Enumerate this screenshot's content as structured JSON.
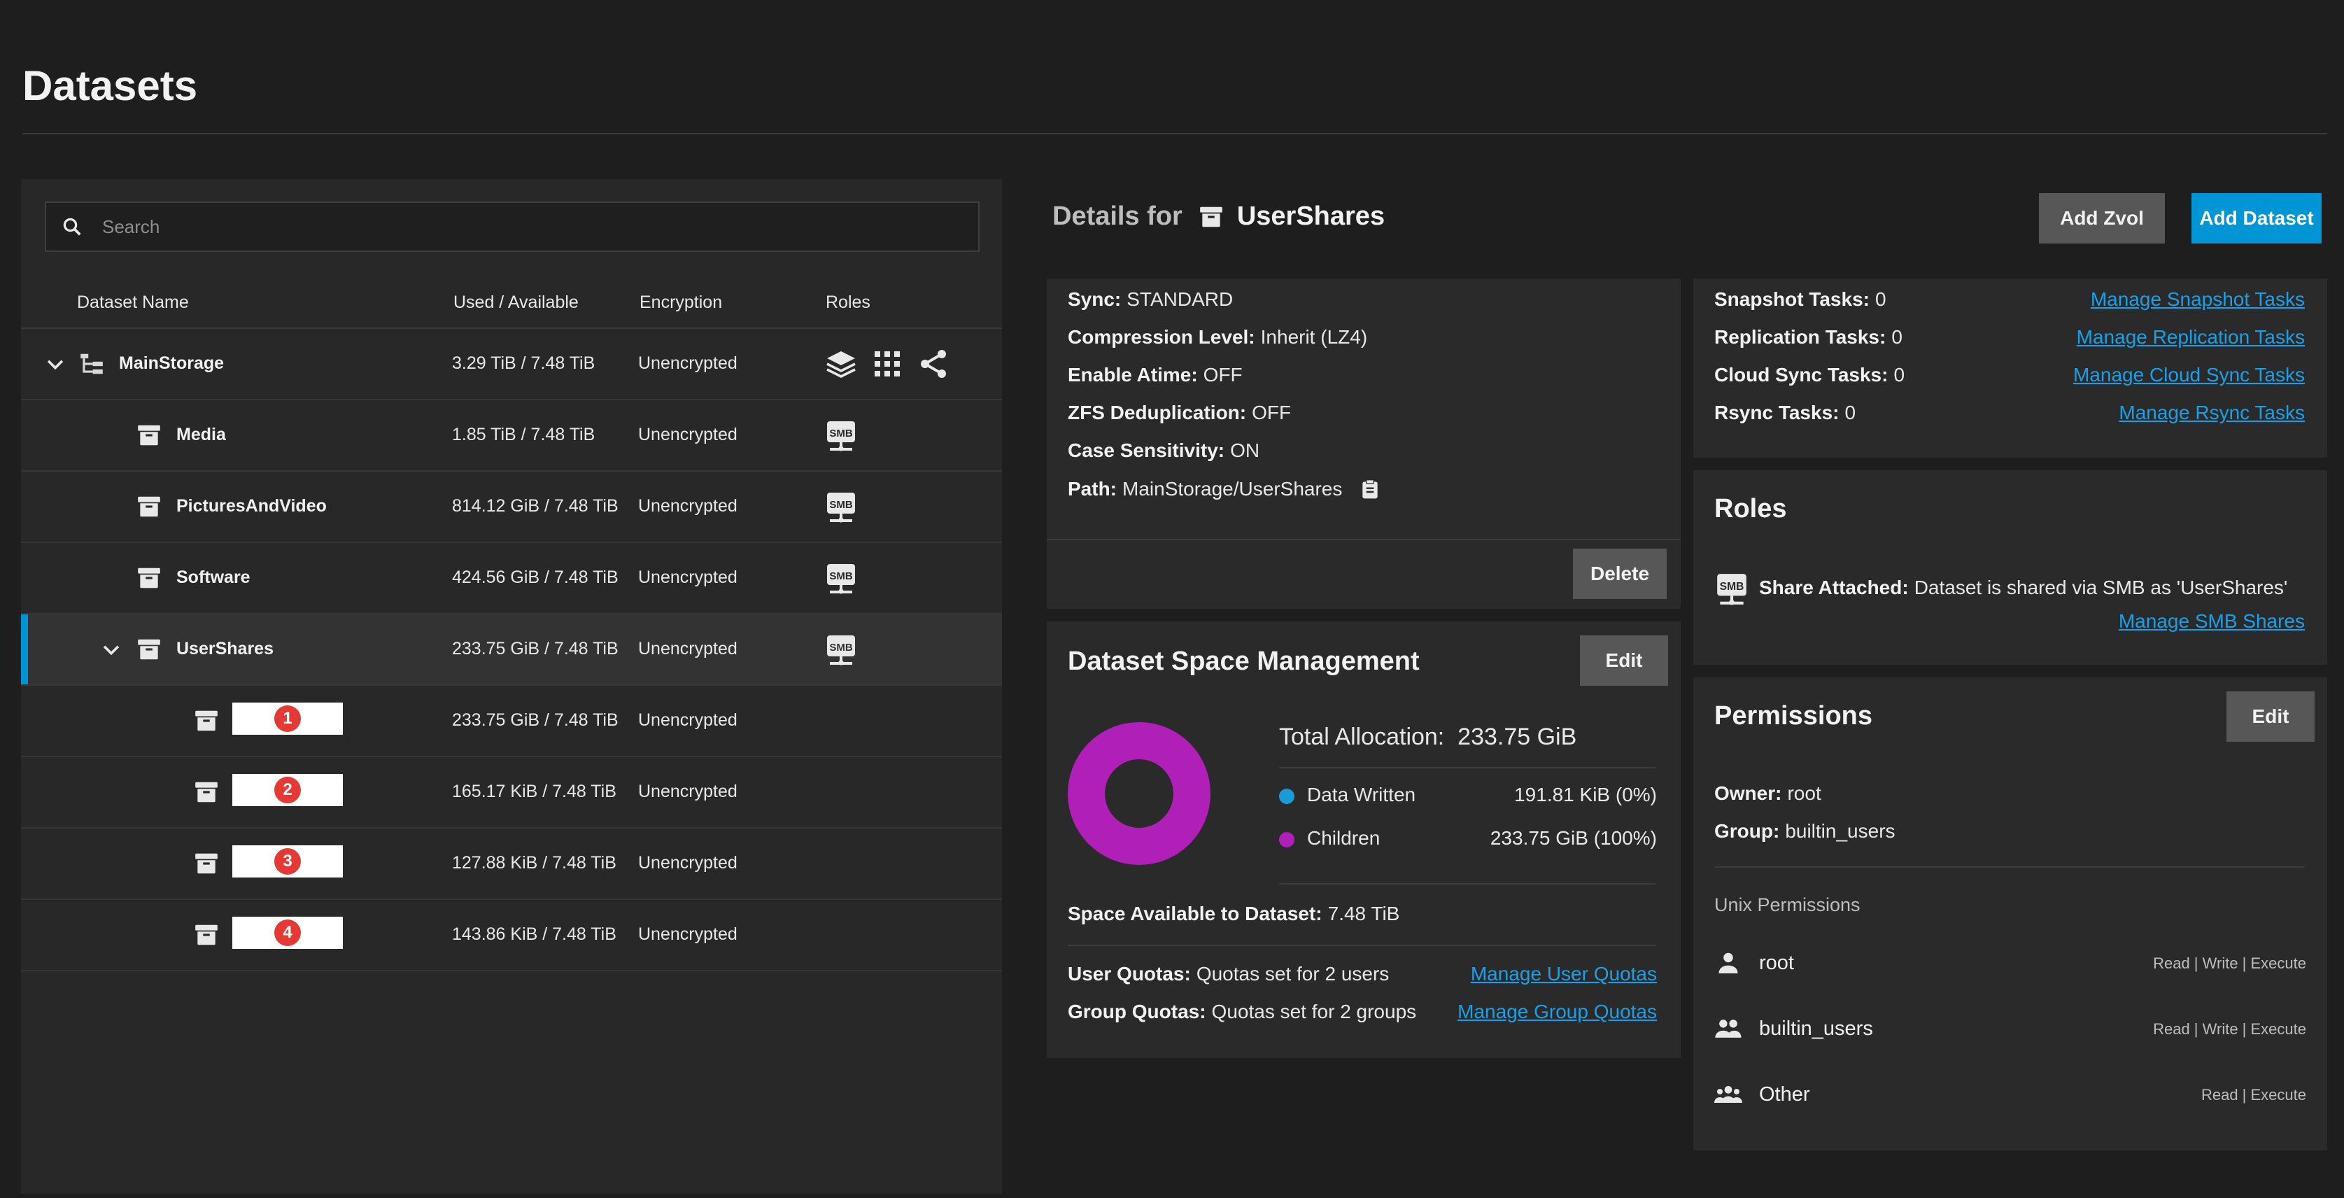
{
  "page": {
    "title": "Datasets"
  },
  "search": {
    "placeholder": "Search"
  },
  "tree": {
    "columns": {
      "name": "Dataset Name",
      "used": "Used / Available",
      "encryption": "Encryption",
      "roles": "Roles"
    },
    "rows": [
      {
        "name": "MainStorage",
        "used": "3.29 TiB / 7.48 TiB",
        "encryption": "Unencrypted",
        "roles": [
          "storage-stack-icon",
          "apps-grid-icon",
          "share-icon"
        ]
      },
      {
        "name": "Media",
        "used": "1.85 TiB / 7.48 TiB",
        "encryption": "Unencrypted",
        "roles": [
          "smb-share-icon"
        ]
      },
      {
        "name": "PicturesAndVideo",
        "used": "814.12 GiB / 7.48 TiB",
        "encryption": "Unencrypted",
        "roles": [
          "smb-share-icon"
        ]
      },
      {
        "name": "Software",
        "used": "424.56 GiB / 7.48 TiB",
        "encryption": "Unencrypted",
        "roles": [
          "smb-share-icon"
        ]
      },
      {
        "name": "UserShares",
        "used": "233.75 GiB / 7.48 TiB",
        "encryption": "Unencrypted",
        "roles": [
          "smb-share-icon"
        ]
      },
      {
        "badge": "1",
        "used": "233.75 GiB / 7.48 TiB",
        "encryption": "Unencrypted"
      },
      {
        "badge": "2",
        "used": "165.17 KiB / 7.48 TiB",
        "encryption": "Unencrypted"
      },
      {
        "badge": "3",
        "used": "127.88 KiB / 7.48 TiB",
        "encryption": "Unencrypted"
      },
      {
        "badge": "4",
        "used": "143.86 KiB / 7.48 TiB",
        "encryption": "Unencrypted"
      }
    ],
    "smb_label": "SMB"
  },
  "details": {
    "prefix": "Details for",
    "dataset": "UserShares",
    "add_zvol": "Add Zvol",
    "add_dataset": "Add Dataset",
    "info": {
      "sync_label": "Sync:",
      "sync": "STANDARD",
      "compression_label": "Compression Level:",
      "compression": "Inherit (LZ4)",
      "atime_label": "Enable Atime:",
      "atime": "OFF",
      "dedup_label": "ZFS Deduplication:",
      "dedup": "OFF",
      "case_label": "Case Sensitivity:",
      "case": "ON",
      "path_label": "Path:",
      "path": "MainStorage/UserShares",
      "delete": "Delete"
    },
    "tasks": {
      "snapshot_label": "Snapshot Tasks:",
      "snapshot": "0",
      "snapshot_link": "Manage Snapshot Tasks",
      "replication_label": "Replication Tasks:",
      "replication": "0",
      "replication_link": "Manage Replication Tasks",
      "cloud_label": "Cloud Sync Tasks:",
      "cloud": "0",
      "cloud_link": "Manage Cloud Sync Tasks",
      "rsync_label": "Rsync Tasks:",
      "rsync": "0",
      "rsync_link": "Manage Rsync Tasks"
    },
    "space": {
      "title": "Dataset Space Management",
      "edit": "Edit",
      "total_label": "Total Allocation:",
      "total": "233.75 GiB",
      "legend": [
        {
          "name": "Data Written",
          "value": "191.81 KiB (0%)",
          "color": "#1a9ad6",
          "fraction": 0.0
        },
        {
          "name": "Children",
          "value": "233.75 GiB (100%)",
          "color": "#b01fb8",
          "fraction": 1.0
        }
      ],
      "available_label": "Space Available to Dataset:",
      "available": "7.48 TiB",
      "user_quota_label": "User Quotas:",
      "user_quota": "Quotas set for 2 users",
      "user_quota_link": "Manage User Quotas",
      "group_quota_label": "Group Quotas:",
      "group_quota": "Quotas set for 2 groups",
      "group_quota_link": "Manage Group Quotas"
    },
    "roles": {
      "title": "Roles",
      "share_label": "Share Attached:",
      "share_text": "Dataset is shared via SMB as 'UserShares'",
      "manage_link": "Manage SMB Shares"
    },
    "permissions": {
      "title": "Permissions",
      "edit": "Edit",
      "owner_label": "Owner:",
      "owner": "root",
      "group_label": "Group:",
      "group": "builtin_users",
      "unix_label": "Unix Permissions",
      "entries": [
        {
          "who": "root",
          "rights": "Read | Write | Execute",
          "icon": "user-icon"
        },
        {
          "who": "builtin_users",
          "rights": "Read | Write | Execute",
          "icon": "group-icon"
        },
        {
          "who": "Other",
          "rights": "Read | Execute",
          "icon": "others-icon"
        }
      ]
    }
  }
}
